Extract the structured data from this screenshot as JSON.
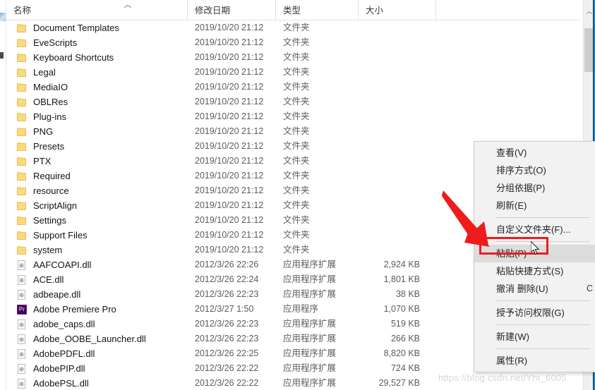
{
  "window": {
    "accent_color": "#1f7ec2"
  },
  "columns": {
    "name": "名称",
    "date_modified": "修改日期",
    "type": "类型",
    "size": "大小",
    "sort_caret": "︿"
  },
  "files": [
    {
      "icon": "folder-icon",
      "name": "Document Templates",
      "date": "2019/10/20 21:12",
      "type": "文件夹",
      "size": ""
    },
    {
      "icon": "folder-icon",
      "name": "EveScripts",
      "date": "2019/10/20 21:12",
      "type": "文件夹",
      "size": ""
    },
    {
      "icon": "folder-icon",
      "name": "Keyboard Shortcuts",
      "date": "2019/10/20 21:12",
      "type": "文件夹",
      "size": ""
    },
    {
      "icon": "folder-icon",
      "name": "Legal",
      "date": "2019/10/20 21:12",
      "type": "文件夹",
      "size": ""
    },
    {
      "icon": "folder-icon",
      "name": "MediaIO",
      "date": "2019/10/20 21:12",
      "type": "文件夹",
      "size": ""
    },
    {
      "icon": "folder-icon",
      "name": "OBLRes",
      "date": "2019/10/20 21:12",
      "type": "文件夹",
      "size": ""
    },
    {
      "icon": "folder-icon",
      "name": "Plug-ins",
      "date": "2019/10/20 21:12",
      "type": "文件夹",
      "size": ""
    },
    {
      "icon": "folder-icon",
      "name": "PNG",
      "date": "2019/10/20 21:12",
      "type": "文件夹",
      "size": ""
    },
    {
      "icon": "folder-icon",
      "name": "Presets",
      "date": "2019/10/20 21:12",
      "type": "文件夹",
      "size": ""
    },
    {
      "icon": "folder-icon",
      "name": "PTX",
      "date": "2019/10/20 21:12",
      "type": "文件夹",
      "size": ""
    },
    {
      "icon": "folder-icon",
      "name": "Required",
      "date": "2019/10/20 21:12",
      "type": "文件夹",
      "size": ""
    },
    {
      "icon": "folder-icon",
      "name": "resource",
      "date": "2019/10/20 21:12",
      "type": "文件夹",
      "size": ""
    },
    {
      "icon": "folder-icon",
      "name": "ScriptAlign",
      "date": "2019/10/20 21:12",
      "type": "文件夹",
      "size": ""
    },
    {
      "icon": "folder-icon",
      "name": "Settings",
      "date": "2019/10/20 21:12",
      "type": "文件夹",
      "size": ""
    },
    {
      "icon": "folder-icon",
      "name": "Support Files",
      "date": "2019/10/20 21:12",
      "type": "文件夹",
      "size": ""
    },
    {
      "icon": "folder-icon",
      "name": "system",
      "date": "2019/10/20 21:12",
      "type": "文件夹",
      "size": ""
    },
    {
      "icon": "dll-icon",
      "name": "AAFCOAPI.dll",
      "date": "2012/3/26 22:26",
      "type": "应用程序扩展",
      "size": "2,924 KB"
    },
    {
      "icon": "dll-icon",
      "name": "ACE.dll",
      "date": "2012/3/26 22:24",
      "type": "应用程序扩展",
      "size": "1,801 KB"
    },
    {
      "icon": "dll-icon",
      "name": "adbeape.dll",
      "date": "2012/3/26 22:23",
      "type": "应用程序扩展",
      "size": "38 KB"
    },
    {
      "icon": "premiere-pro-icon",
      "name": "Adobe Premiere Pro",
      "date": "2012/3/27 1:50",
      "type": "应用程序",
      "size": "1,070 KB"
    },
    {
      "icon": "dll-icon",
      "name": "adobe_caps.dll",
      "date": "2012/3/26 22:23",
      "type": "应用程序扩展",
      "size": "519 KB"
    },
    {
      "icon": "dll-icon",
      "name": "Adobe_OOBE_Launcher.dll",
      "date": "2012/3/26 22:23",
      "type": "应用程序扩展",
      "size": "266 KB"
    },
    {
      "icon": "dll-icon",
      "name": "AdobePDFL.dll",
      "date": "2012/3/26 22:25",
      "type": "应用程序扩展",
      "size": "8,820 KB"
    },
    {
      "icon": "dll-icon",
      "name": "AdobePIP.dll",
      "date": "2012/3/26 22:22",
      "type": "应用程序扩展",
      "size": "724 KB"
    },
    {
      "icon": "dll-icon",
      "name": "AdobePSL.dll",
      "date": "2012/3/26 22:22",
      "type": "应用程序扩展",
      "size": "29,527 KB"
    }
  ],
  "context_menu": {
    "items": [
      {
        "label": "查看(V)",
        "accel": "",
        "separator_after": false,
        "selected": false
      },
      {
        "label": "排序方式(O)",
        "accel": "",
        "separator_after": false,
        "selected": false
      },
      {
        "label": "分组依据(P)",
        "accel": "",
        "separator_after": false,
        "selected": false
      },
      {
        "label": "刷新(E)",
        "accel": "",
        "separator_after": true,
        "selected": false
      },
      {
        "label": "自定义文件夹(F)...",
        "accel": "",
        "separator_after": true,
        "selected": false
      },
      {
        "label": "粘贴(P)",
        "accel": "",
        "separator_after": false,
        "selected": true
      },
      {
        "label": "粘贴快捷方式(S)",
        "accel": "",
        "separator_after": false,
        "selected": false
      },
      {
        "label": "撤消 删除(U)",
        "accel": "C",
        "separator_after": true,
        "selected": false
      },
      {
        "label": "授予访问权限(G)",
        "accel": "",
        "separator_after": true,
        "selected": false
      },
      {
        "label": "新建(W)",
        "accel": "",
        "separator_after": true,
        "selected": false
      },
      {
        "label": "属性(R)",
        "accel": "",
        "separator_after": false,
        "selected": false
      }
    ]
  },
  "annotations": {
    "highlight_color": "#ee1c1c",
    "highlight_target": "粘贴(P)"
  },
  "scrollbar": {
    "up_arrow": "︿"
  },
  "watermark": {
    "text": "https://blog.csdn.net/Yht_6005"
  }
}
